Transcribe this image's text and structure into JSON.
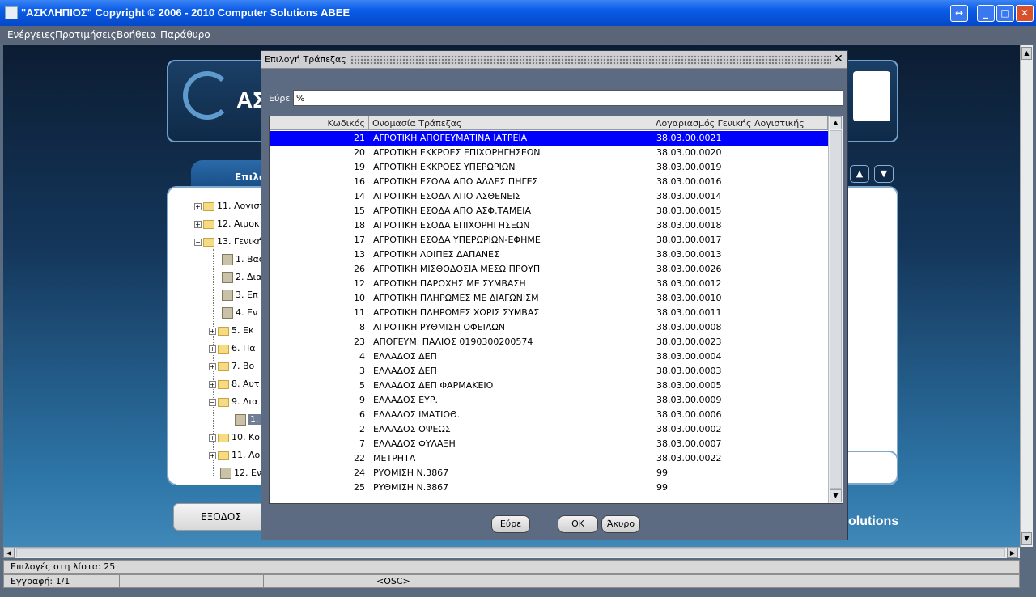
{
  "window": {
    "title": "\"ΑΣΚΛΗΠΙΟΣ\" Copyright © 2006 - 2010 Computer Solutions ABEE",
    "controls": [
      "↔",
      "_",
      "□",
      "✕"
    ]
  },
  "menu": [
    "Ενέργειες",
    "Προτιμήσεις",
    "Βοήθεια",
    "Παράθυρο"
  ],
  "background": {
    "logo_text": "ΑΣ",
    "tab_label": "Επιλο",
    "nav_up": "▲",
    "nav_down": "▼",
    "tree": [
      {
        "label": "11. Λογιστ",
        "type": "folder",
        "exp": "+"
      },
      {
        "label": "12. Αιμοκ",
        "type": "folder",
        "exp": "+"
      },
      {
        "label": "13. Γενική",
        "type": "folder-open",
        "exp": "−"
      },
      {
        "label": "1. Βασ",
        "type": "doc"
      },
      {
        "label": "2. Δια",
        "type": "doc"
      },
      {
        "label": "3. Επ",
        "type": "doc"
      },
      {
        "label": "4. Εν",
        "type": "doc"
      },
      {
        "label": "5. Εκ",
        "type": "folder",
        "exp": "+"
      },
      {
        "label": "6. Πα",
        "type": "folder",
        "exp": "+"
      },
      {
        "label": "7. Βο",
        "type": "folder",
        "exp": "+"
      },
      {
        "label": "8. Αυτ",
        "type": "folder",
        "exp": "+"
      },
      {
        "label": "9. Δια",
        "type": "folder-open",
        "exp": "−"
      },
      {
        "label": "1.",
        "type": "doc-selected"
      },
      {
        "label": "10. Κο",
        "type": "folder",
        "exp": "+"
      },
      {
        "label": "11. Λο",
        "type": "folder",
        "exp": "+"
      },
      {
        "label": "12. Εν",
        "type": "doc"
      }
    ],
    "exit_label": "ΕΞΟΔΟΣ",
    "brand": "olutions"
  },
  "dialog": {
    "title": "Επιλογή Τράπεζας",
    "close": "✕",
    "find_label": "Εύρε",
    "find_value": "%",
    "columns": [
      "Κωδικός",
      "Ονομασία Τράπεζας",
      "Λογαριασμός Γενικής Λογιστικής"
    ],
    "rows": [
      [
        "21",
        "ΑΓΡΟΤΙΚΗ ΑΠΟΓΕΥΜΑΤΙΝΑ ΙΑΤΡΕΙΑ",
        "38.03.00.0021"
      ],
      [
        "20",
        "ΑΓΡΟΤΙΚΗ ΕΚΚΡΟΕΣ ΕΠΙΧΟΡΗΓΗΣΕΩΝ",
        "38.03.00.0020"
      ],
      [
        "19",
        "ΑΓΡΟΤΙΚΗ ΕΚΚΡΟΕΣ ΥΠΕΡΩΡΙΩΝ",
        "38.03.00.0019"
      ],
      [
        "16",
        "ΑΓΡΟΤΙΚΗ ΕΣΟΔΑ ΑΠΟ ΑΛΛΕΣ ΠΗΓΕΣ",
        "38.03.00.0016"
      ],
      [
        "14",
        "ΑΓΡΟΤΙΚΗ ΕΣΟΔΑ ΑΠΟ ΑΣΘΕΝΕΙΣ",
        "38.03.00.0014"
      ],
      [
        "15",
        "ΑΓΡΟΤΙΚΗ ΕΣΟΔΑ ΑΠΟ ΑΣΦ.ΤΑΜΕΙΑ",
        "38.03.00.0015"
      ],
      [
        "18",
        "ΑΓΡΟΤΙΚΗ ΕΣΟΔΑ ΕΠΙΧΟΡΗΓΗΣΕΩΝ",
        "38.03.00.0018"
      ],
      [
        "17",
        "ΑΓΡΟΤΙΚΗ ΕΣΟΔΑ ΥΠΕΡΩΡΙΩΝ-ΕΦΗΜΕ",
        "38.03.00.0017"
      ],
      [
        "13",
        "ΑΓΡΟΤΙΚΗ ΛΟΙΠΕΣ ΔΑΠΑΝΕΣ",
        "38.03.00.0013"
      ],
      [
        "26",
        "ΑΓΡΟΤΙΚΗ ΜΙΣΘΟΔΟΣΙΑ ΜΕΣΩ ΠΡΟΥΠ",
        "38.03.00.0026"
      ],
      [
        "12",
        "ΑΓΡΟΤΙΚΗ ΠΑΡΟΧΗΣ ΜΕ ΣΥΜΒΑΣΗ",
        "38.03.00.0012"
      ],
      [
        "10",
        "ΑΓΡΟΤΙΚΗ ΠΛΗΡΩΜΕΣ ΜΕ ΔΙΑΓΩΝΙΣΜ",
        "38.03.00.0010"
      ],
      [
        "11",
        "ΑΓΡΟΤΙΚΗ ΠΛΗΡΩΜΕΣ ΧΩΡΙΣ ΣΥΜΒΑΣ",
        "38.03.00.0011"
      ],
      [
        "8",
        "ΑΓΡΟΤΙΚΗ ΡΥΘΜΙΣΗ ΟΦΕΙΛΩΝ",
        "38.03.00.0008"
      ],
      [
        "23",
        "ΑΠΟΓΕΥΜ. ΠΑΛΙΟΣ 0190300200574",
        "38.03.00.0023"
      ],
      [
        "4",
        "ΕΛΛΑΔΟΣ ΔΕΠ",
        "38.03.00.0004"
      ],
      [
        "3",
        "ΕΛΛΑΔΟΣ ΔΕΠ",
        "38.03.00.0003"
      ],
      [
        "5",
        "ΕΛΛΑΔΟΣ ΔΕΠ ΦΑΡΜΑΚΕΙΟ",
        "38.03.00.0005"
      ],
      [
        "9",
        "ΕΛΛΑΔΟΣ ΕΥΡ.",
        "38.03.00.0009"
      ],
      [
        "6",
        "ΕΛΛΑΔΟΣ ΙΜΑΤΙΟΘ.",
        "38.03.00.0006"
      ],
      [
        "2",
        "ΕΛΛΑΔΟΣ ΟΨΕΩΣ",
        "38.03.00.0002"
      ],
      [
        "7",
        "ΕΛΛΑΔΟΣ ΦΥΛΑΞΗ",
        "38.03.00.0007"
      ],
      [
        "22",
        "ΜΕΤΡΗΤΑ",
        "38.03.00.0022"
      ],
      [
        "24",
        "ΡΥΘΜΙΣΗ Ν.3867",
        "99"
      ],
      [
        "25",
        "ΡΥΘΜΙΣΗ Ν.3867",
        "99"
      ]
    ],
    "selected_index": 0,
    "buttons": {
      "find": "Εύρε",
      "ok": "OK",
      "cancel": "Άκυρο"
    }
  },
  "status": {
    "list_count": "Επιλογές στη λίστα: 25",
    "record": "Εγγραφή: 1/1",
    "mode": "<OSC>"
  }
}
